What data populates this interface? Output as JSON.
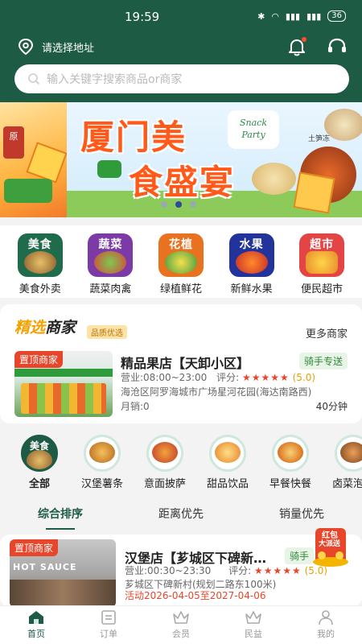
{
  "status_bar": {
    "time": "19:59",
    "signal_left": "▮▮▮",
    "signal_right": "▮▮▮",
    "battery": "36"
  },
  "header": {
    "location_label": "请选择地址"
  },
  "search": {
    "placeholder": "输入关键字搜索商品or商家"
  },
  "banner": {
    "title_line1": "厦门美",
    "title_line2": "食盛宴",
    "badge_line1": "Snack",
    "badge_line2": "Party",
    "side_label": "土笋冻",
    "left_text": "原"
  },
  "categories": [
    {
      "icon_label": "美食",
      "label": "美食外卖",
      "color": "#1f6b4c"
    },
    {
      "icon_label": "蔬菜",
      "label": "蔬菜肉禽",
      "color": "#7c3aa6"
    },
    {
      "icon_label": "花植",
      "label": "绿植鲜花",
      "color": "#e8721f"
    },
    {
      "icon_label": "水果",
      "label": "新鲜水果",
      "color": "#22349c"
    },
    {
      "icon_label": "超市",
      "label": "便民超市",
      "color": "#e34545"
    }
  ],
  "featured": {
    "title_part1": "精选",
    "title_part2": "商家",
    "tag": "品质优选",
    "more": "更多商家",
    "shop": {
      "badge": "置顶商家",
      "name": "精品果店【天卸小区】",
      "delivery_tag": "骑手专送",
      "hours": "营业:08:00~23:00",
      "score_label": "评分:",
      "stars": "★★★★★",
      "score": "(5.0)",
      "address": "海沧区阿罗海城市广场星河花园(海达南路西)",
      "monthly_sales": "月销:0",
      "distance": "40分钟"
    }
  },
  "subcategories": [
    {
      "label": "全部",
      "icon_label": "美食",
      "active": true
    },
    {
      "label": "汉堡薯条",
      "active": false
    },
    {
      "label": "意面披萨",
      "active": false
    },
    {
      "label": "甜品饮品",
      "active": false
    },
    {
      "label": "早餐快餐",
      "active": false
    },
    {
      "label": "卤菜泡爪",
      "active": false
    }
  ],
  "sort_tabs": [
    {
      "label": "综合排序",
      "active": true
    },
    {
      "label": "距离优先",
      "active": false
    },
    {
      "label": "销量优先",
      "active": false
    }
  ],
  "shop2": {
    "badge": "置顶商家",
    "name": "汉堡店【芗城区下碑新…",
    "delivery_tag": "骑手",
    "hours": "营业:00:30~23:30",
    "score_label": "评分:",
    "stars": "★★★★★",
    "score": "(5.0)",
    "address": "芗城区下碑新村(规划二路东100米)",
    "activity": "活动2026-04-05至2027-04-06",
    "img_text": "HOT SAUCE"
  },
  "red_packet": {
    "line1": "红包",
    "line2": "大派送"
  },
  "tabbar": [
    {
      "label": "首页",
      "icon": "home-icon",
      "active": true
    },
    {
      "label": "订单",
      "icon": "order-icon",
      "active": false
    },
    {
      "label": "会员",
      "icon": "crown-icon",
      "active": false
    },
    {
      "label": "民益",
      "icon": "crown-icon",
      "active": false
    },
    {
      "label": "我的",
      "icon": "user-icon",
      "active": false
    }
  ],
  "colors": {
    "primary": "#1e5b45",
    "accent_red": "#e8462b",
    "accent_yellow": "#f5a000"
  }
}
